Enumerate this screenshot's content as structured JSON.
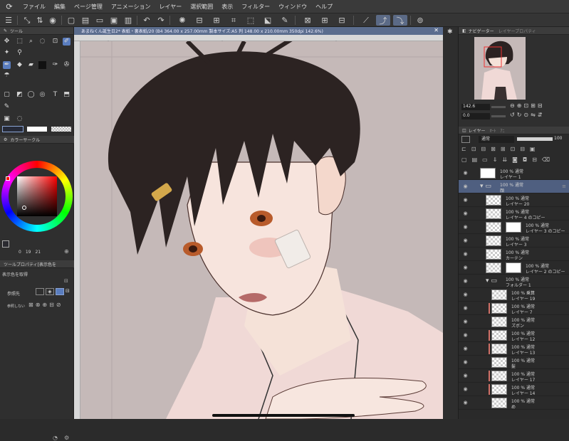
{
  "app": {
    "logo_glyph": "⟳"
  },
  "menu": [
    "ファイル",
    "編集",
    "ページ管理",
    "アニメーション",
    "レイヤー",
    "選択範囲",
    "表示",
    "フィルター",
    "ウィンドウ",
    "ヘルプ"
  ],
  "tool_panel": {
    "title": "ツール"
  },
  "color_panel": {
    "title": "カラーサークル",
    "h_value": "0",
    "s_value": "19",
    "v_value": "21",
    "main_color": "#2a2a30",
    "sub_color": "#ffffff"
  },
  "tool_property": {
    "title": "ツールプロパティ[表示色を",
    "subtitle": "表示色を取得",
    "ref_label": "参照先",
    "ref_none_label": "参照しない"
  },
  "document": {
    "title": "あまねくん誕生日2* 表紙・裏表紙/20 (B4 364.00 x 257.00mm 製本サイズ:A5 判 148.00 x 210.00mm 350dpi 142.6%)",
    "close": "✕"
  },
  "navigator": {
    "tab1": "ナビゲーター",
    "tab2": "レイヤープロパティ",
    "zoom": "142.6",
    "rotation": "0.0"
  },
  "layer_panel": {
    "tab_layer": "レイヤー",
    "tab_other1": "ｵｰﾄ",
    "tab_other2": "ｱﾆ",
    "blend_mode": "通常",
    "opacity": "100",
    "layers": [
      {
        "line1": "100 % 通常",
        "line2": "レイヤー 1",
        "kind": "white",
        "indent": 0,
        "eye": true
      },
      {
        "line1": "100 % 通常",
        "line2": "顔",
        "kind": "folder",
        "indent": 0,
        "eye": true,
        "selected": true
      },
      {
        "line1": "100 % 通常",
        "line2": "レイヤー 20",
        "kind": "trans",
        "indent": 1,
        "eye": true
      },
      {
        "line1": "100 % 通常",
        "line2": "レイヤー 4 のコピー",
        "kind": "trans",
        "indent": 1,
        "eye": true
      },
      {
        "line1": "100 % 通常",
        "line2": "レイヤー 3 のコピー",
        "kind": "mask",
        "indent": 1,
        "eye": true
      },
      {
        "line1": "100 % 通常",
        "line2": "レイヤー 3",
        "kind": "trans",
        "indent": 1,
        "eye": true
      },
      {
        "line1": "100 % 通常",
        "line2": "カーテン",
        "kind": "trans",
        "indent": 1,
        "eye": true
      },
      {
        "line1": "100 % 通常",
        "line2": "レイヤー 2 のコピー",
        "kind": "mask",
        "indent": 1,
        "eye": true
      },
      {
        "line1": "100 % 通常",
        "line2": "フォルダー 1",
        "kind": "folder",
        "indent": 1,
        "eye": true
      },
      {
        "line1": "100 % 乗算",
        "line2": "レイヤー 19",
        "kind": "trans",
        "indent": 2,
        "eye": true
      },
      {
        "line1": "100 % 通常",
        "line2": "レイヤー 7",
        "kind": "trans",
        "indent": 2,
        "eye": true,
        "clip": true
      },
      {
        "line1": "100 % 通常",
        "line2": "ズボン",
        "kind": "trans",
        "indent": 2,
        "eye": true
      },
      {
        "line1": "100 % 通常",
        "line2": "レイヤー 12",
        "kind": "trans",
        "indent": 2,
        "eye": true,
        "clip": true
      },
      {
        "line1": "100 % 通常",
        "line2": "レイヤー 13",
        "kind": "trans",
        "indent": 2,
        "eye": true,
        "clip": true
      },
      {
        "line1": "100 % 通常",
        "line2": "髪",
        "kind": "trans",
        "indent": 2,
        "eye": true
      },
      {
        "line1": "100 % 通常",
        "line2": "レイヤー 17",
        "kind": "trans",
        "indent": 2,
        "eye": true,
        "clip": true
      },
      {
        "line1": "100 % 通常",
        "line2": "レイヤー 14",
        "kind": "trans",
        "indent": 2,
        "eye": true,
        "clip": true
      },
      {
        "line1": "100 % 通常",
        "line2": "め",
        "kind": "trans",
        "indent": 2,
        "eye": true
      }
    ]
  },
  "colors": {
    "accent": "#5b6d8e",
    "selected_layer": "#4f5f80",
    "canvas_bg": "#c1b6b5"
  }
}
